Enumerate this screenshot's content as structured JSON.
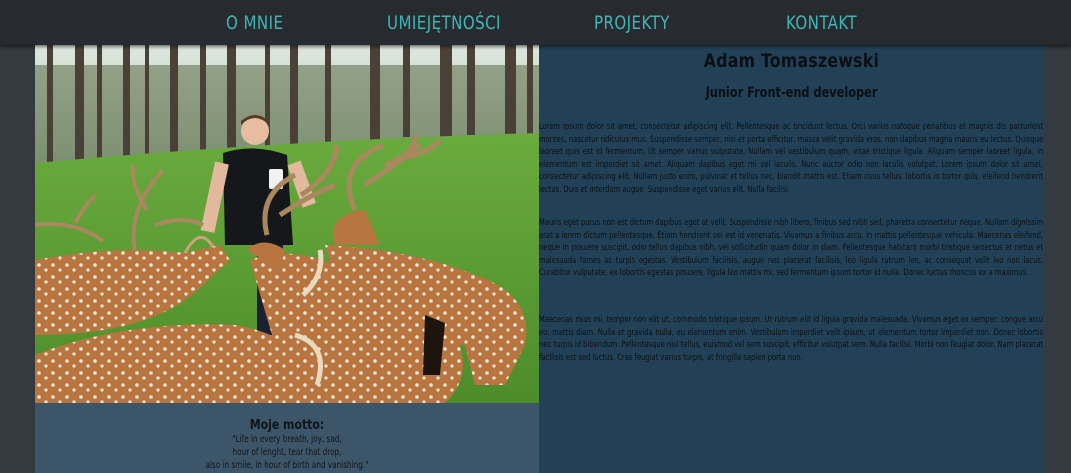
{
  "nav": {
    "items": [
      "O MNIE",
      "UMIEJĘTNOŚCI",
      "PROJEKTY",
      "KONTAKT"
    ]
  },
  "colors": {
    "nav_bg": "#272b30",
    "nav_text": "#3fb6b6",
    "page_bg": "#343a40",
    "profile_bg": "#224157",
    "motto_bg": "#3c5568"
  },
  "photo": {
    "description_icon": "photo-man-feeding-deer"
  },
  "motto": {
    "title": "Moje motto:",
    "lines": [
      "\"Life in every breath, joy, sad,",
      "hour of lenght, tear that drop,",
      "also in smile, in hour of birth and vanishing.\""
    ]
  },
  "profile": {
    "name": "Adam Tomaszewski",
    "role": "Junior Front-end developer",
    "paragraphs": [
      "Lorem ipsum dolor sit amet, consectetur adipiscing elit. Pellentesque ac tincidunt lectus. Orci varius natoque penatibus et magnis dis parturient montes, nascetur ridiculus mus. Suspendisse semper, nisi et porta efficitur, massa velit gravida eros, non dapibus magna mauris eu lectus. Quisque laoreet quis est id fermentum. Ut semper varius vulputate. Nullam vel vestibulum quam, vitae tristique ligula. Aliquam semper laoreet ligula, in elementum est imperdiet sit amet. Aliquam dapibus eget mi vel iaculis. Nunc auctor odio non iaculis volutpat. Lorem ipsum dolor sit amet, consectetur adipiscing elit. Nullam justo enim, pulvinar et tellus nec, blandit mattis est. Etiam risus tellus, lobortis in tortor quis, eleifend hendrerit lectus. Duis et interdum augue. Suspendisse eget varius elit. Nulla facilisi.",
      "Mauris eget purus non est dictum dapibus eget at velit. Suspendisse nibh libero, finibus sed nibh sed, pharetra consectetur neque. Nullam dignissim erat a lorem dictum pellentesque. Etiam hendrerit vel est id venenatis. Vivamus a finibus arcu. In mattis pellentesque vehicula. Maecenas eleifend, neque in posuere suscipit, odio tellus dapibus nibh, vel sollicitudin quam dolor in diam. Pellentesque habitant morbi tristique senectus et netus et malesuada fames ac turpis egestas. Vestibulum facilisis, augue nec placerat facilisis, leo ligula rutrum leo, ac consequat velit leo non lacus. Curabitur vulputate, ex lobortis egestas posuere, ligula leo mattis mi, sed fermentum ipsum tortor id nulla. Donec luctus rhoncus ex a maximus.",
      "Maecenas risus mi, tempor non elit ut, commodo tristique ipsum. Ut rutrum elit id ligula gravida malesuada. Vivamus eget ex semper, congue arcu eu, mattis diam. Nulla et gravida nulla, eu elementum enim. Vestibulum imperdiet velit ipsum, ut elementum tortor imperdiet non. Donec lobortis nec turpis id bibendum. Pellentesque nisl tellus, euismod vel sem suscipit, efficitur volutpat sem. Nulla facilisi. Morbi non feugiat dolor. Nam placerat facilisis est sed luctus. Cras feugiat varius turpis, at fringilla sapien porta non."
    ]
  }
}
